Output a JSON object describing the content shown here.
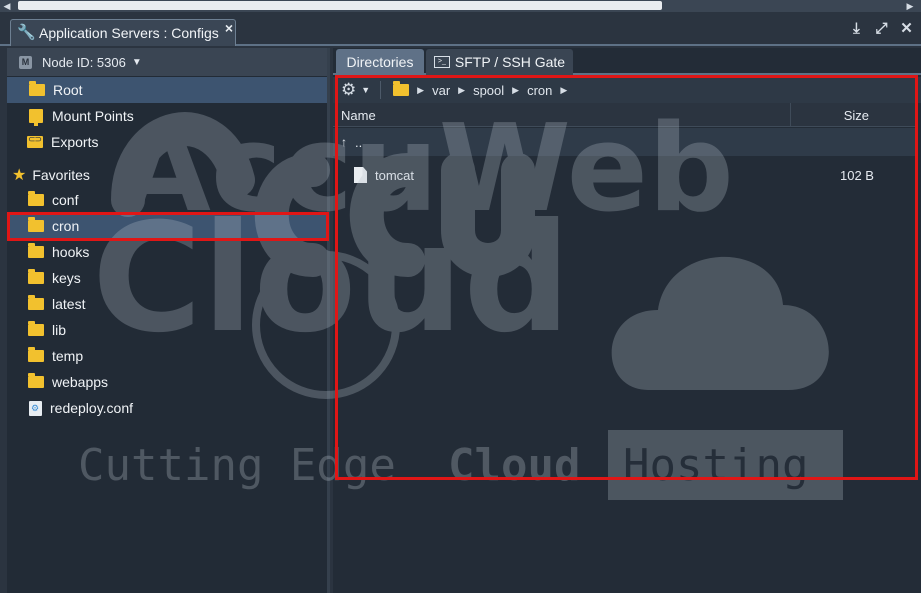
{
  "window": {
    "title": "Application Servers : Configs",
    "close_glyph": "×"
  },
  "left_panel": {
    "node_label": "Node ID: 5306",
    "node_badge": "M",
    "roots": [
      {
        "label": "Root",
        "icon": "folder-icon"
      },
      {
        "label": "Mount Points",
        "icon": "mount-icon"
      },
      {
        "label": "Exports",
        "icon": "exports-icon"
      }
    ],
    "favorites_label": "Favorites",
    "favorites": [
      {
        "label": "conf"
      },
      {
        "label": "cron"
      },
      {
        "label": "hooks"
      },
      {
        "label": "keys"
      },
      {
        "label": "latest"
      },
      {
        "label": "lib"
      },
      {
        "label": "temp"
      },
      {
        "label": "webapps"
      },
      {
        "label": "redeploy.conf"
      }
    ]
  },
  "right_panel": {
    "tabs": [
      {
        "label": "Directories",
        "active": true
      },
      {
        "label": "SFTP / SSH Gate",
        "active": false
      }
    ],
    "breadcrumb": [
      "var",
      "spool",
      "cron"
    ],
    "columns": {
      "name": "Name",
      "size": "Size"
    },
    "up_row_label": "..",
    "files": [
      {
        "name": "tomcat",
        "size": "102 B"
      }
    ]
  },
  "watermark": {
    "line1": "AccuWeb",
    "line2": "Cloud",
    "tagline_left": "Cutting Edge",
    "tagline_mid": "Cloud",
    "tagline_right": "Hosting"
  },
  "colors": {
    "highlight": "#e01616",
    "selection": "#3d5470",
    "folder": "#f2c12e"
  }
}
